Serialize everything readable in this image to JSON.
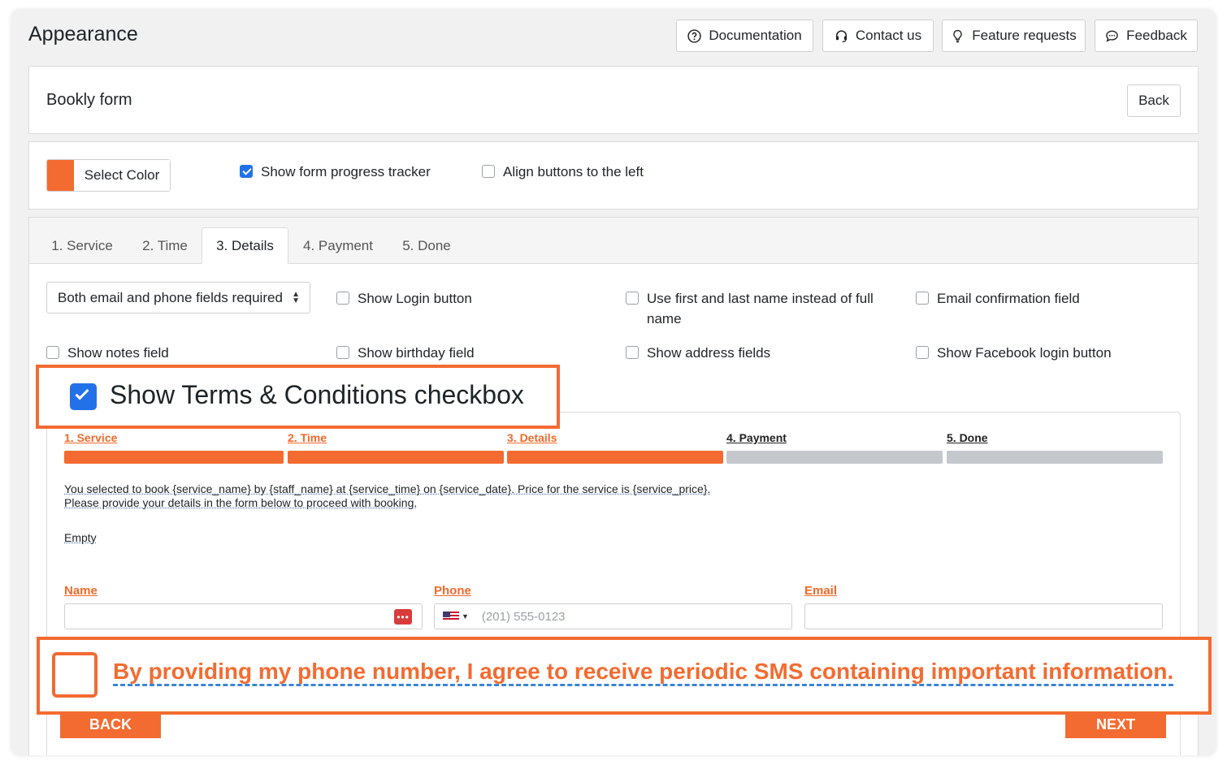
{
  "header": {
    "title": "Appearance",
    "buttons": {
      "documentation": "Documentation",
      "contact": "Contact us",
      "feature": "Feature requests",
      "feedback": "Feedback"
    }
  },
  "form_card": {
    "title": "Bookly form",
    "back_label": "Back"
  },
  "settings": {
    "select_color_label": "Select Color",
    "color": "#f36b31",
    "show_progress_label": "Show form progress tracker",
    "align_buttons_label": "Align buttons to the left"
  },
  "tabs": [
    "1. Service",
    "2. Time",
    "3. Details",
    "4. Payment",
    "5. Done"
  ],
  "details_options": {
    "fields_required": "Both email and phone fields required",
    "show_login": "Show Login button",
    "first_last_name": "Use first and last name instead of full name",
    "email_confirmation": "Email confirmation field",
    "show_notes": "Show notes field",
    "show_birthday": "Show birthday field",
    "show_address": "Show address fields",
    "show_facebook": "Show Facebook login button",
    "show_terms": "Show Terms & Conditions checkbox"
  },
  "preview": {
    "steps": [
      "1. Service",
      "2. Time",
      "3. Details",
      "4. Payment",
      "5. Done"
    ],
    "intro_line1": "You selected to book {service_name} by {staff_name} at {service_time} on {service_date}. Price for the service is {service_price}.",
    "intro_line2": "Please provide your details in the form below to proceed with booking.",
    "empty": "Empty",
    "name_label": "Name",
    "phone_label": "Phone",
    "email_label": "Email",
    "phone_placeholder": "(201) 555-0123",
    "sms_consent": "By providing my phone number, I agree to receive periodic SMS containing important information.",
    "back_label": "BACK",
    "next_label": "NEXT"
  },
  "colors": {
    "accent": "#f36b31",
    "checkbox_blue": "#2271e8",
    "inactive_step": "#c4c8cc"
  }
}
